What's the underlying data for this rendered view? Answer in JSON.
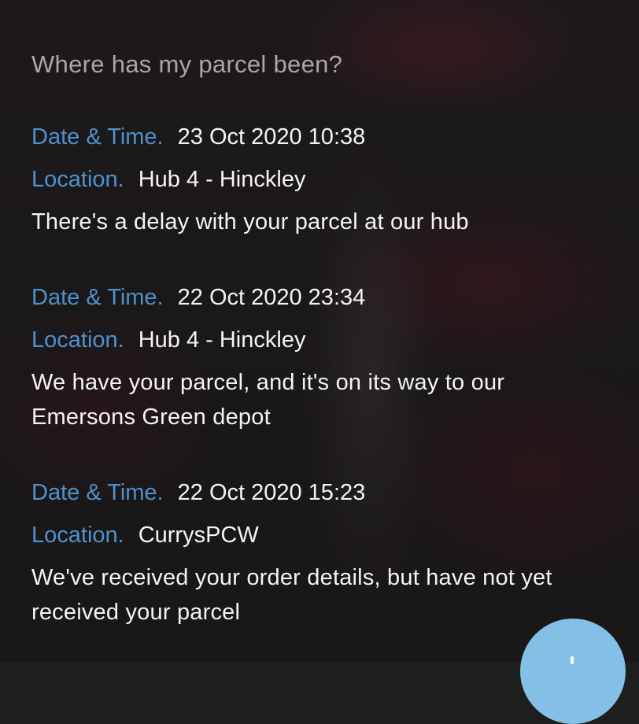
{
  "heading": "Where has my parcel been?",
  "labels": {
    "date_time": "Date & Time.",
    "location": "Location."
  },
  "events": [
    {
      "date_time": "23 Oct 2020 10:38",
      "location": "Hub 4 - Hinckley",
      "description": "There's a delay with your parcel at our hub"
    },
    {
      "date_time": "22 Oct 2020 23:34",
      "location": "Hub 4 - Hinckley",
      "description": "We have your parcel, and it's on its way to our Emersons Green depot"
    },
    {
      "date_time": "22 Oct 2020 15:23",
      "location": "CurrysPCW",
      "description": "We've received your order details, but have not yet received your parcel"
    }
  ],
  "colors": {
    "label": "#4e91cc",
    "text": "#f4f4f4",
    "heading": "#a7a7a9",
    "fab": "#84c0e6"
  }
}
